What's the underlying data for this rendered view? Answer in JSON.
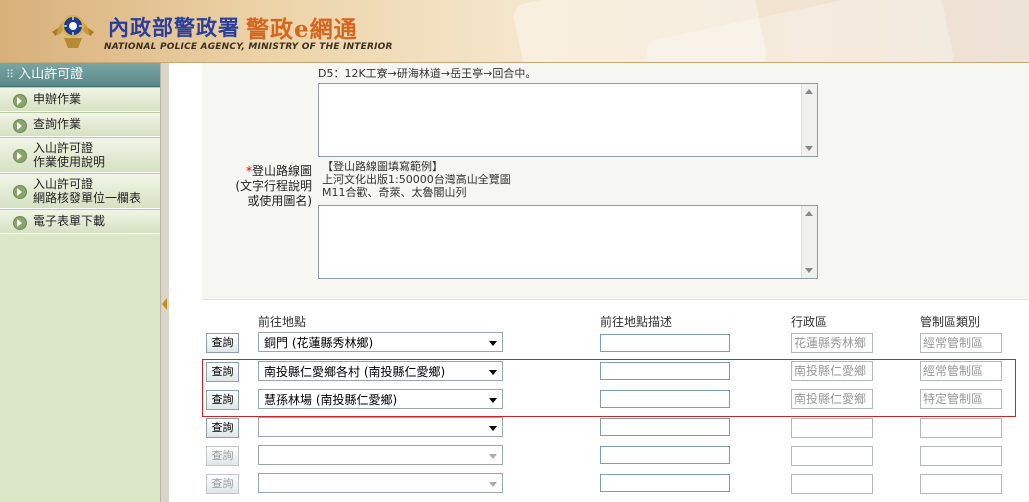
{
  "header": {
    "title_zh_agency": "內政部警政署",
    "title_zh_system": "警政e網通",
    "title_en": "NATIONAL POLICE AGENCY, MINISTRY OF THE INTERIOR"
  },
  "sidebar": {
    "heading": "入山許可證",
    "items": [
      {
        "lines": [
          "申辦作業"
        ]
      },
      {
        "lines": [
          "查詢作業"
        ]
      },
      {
        "lines": [
          "入山許可證",
          "作業使用說明"
        ]
      },
      {
        "lines": [
          "入山許可證",
          "網路核發單位一欄表"
        ]
      },
      {
        "lines": [
          "電子表單下載"
        ]
      }
    ]
  },
  "form": {
    "itinerary_partial_line": "D5：12K工寮→研海林道→岳王亭→回合中。",
    "route_map_label_line1": "登山路線圖",
    "route_map_label_line2": "(文字行程說明",
    "route_map_label_line3": "或使用圖名)",
    "route_map_hint_line1": "【登山路線圖填寫範例】",
    "route_map_hint_line2": "上河文化出版1:50000台灣高山全覽圖",
    "route_map_hint_line3": "M11合歡、奇萊、太魯閣山列"
  },
  "table": {
    "headers": {
      "destination": "前往地點",
      "description": "前往地點描述",
      "district": "行政區",
      "zone_type": "管制區類別"
    },
    "query_label": "查詢",
    "rows": [
      {
        "destination": "銅門 (花蓮縣秀林鄉)",
        "district": "花蓮縣秀林鄉",
        "zone_type": "經常管制區",
        "enabled": "true"
      },
      {
        "destination": "南投縣仁愛鄉各村 (南投縣仁愛鄉)",
        "district": "南投縣仁愛鄉",
        "zone_type": "經常管制區",
        "enabled": "true"
      },
      {
        "destination": "慧孫林場 (南投縣仁愛鄉)",
        "district": "南投縣仁愛鄉",
        "zone_type": "特定管制區",
        "enabled": "true"
      },
      {
        "destination": "",
        "district": "",
        "zone_type": "",
        "enabled": "true"
      },
      {
        "destination": "",
        "district": "",
        "zone_type": "",
        "enabled": "false"
      },
      {
        "destination": "",
        "district": "",
        "zone_type": "",
        "enabled": "false"
      }
    ]
  },
  "colors": {
    "header_blue": "#2a3f9b",
    "header_orange": "#d5661e",
    "sidebar_head": "#5a8888",
    "highlight_border": "#c8262e",
    "required_star": "#cc0000"
  }
}
